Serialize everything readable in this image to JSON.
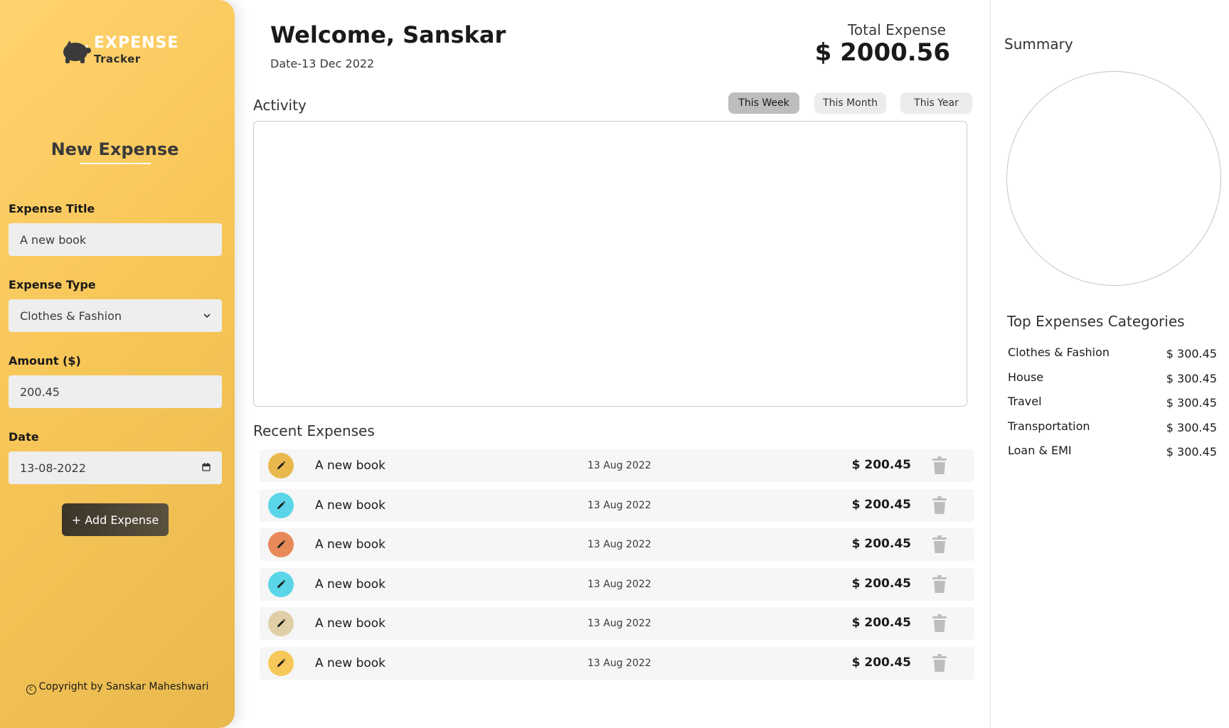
{
  "brand": {
    "title": "EXPENSE",
    "subtitle": "Tracker"
  },
  "form": {
    "heading": "New Expense",
    "title_label": "Expense Title",
    "title_value": "A new book",
    "type_label": "Expense Type",
    "type_value": "Clothes & Fashion",
    "amount_label": "Amount ($)",
    "amount_value": "200.45",
    "date_label": "Date",
    "date_value": "13-08-2022",
    "submit_label": "+ Add Expense"
  },
  "copyright": "Copyright by Sanskar Maheshwari",
  "header": {
    "welcome": "Welcome, Sanskar",
    "date": "Date-13 Dec 2022",
    "total_label": "Total Expense",
    "total_value": "$ 2000.56"
  },
  "activity": {
    "title": "Activity",
    "periods": [
      {
        "label": "This Week",
        "active": true
      },
      {
        "label": "This Month",
        "active": false
      },
      {
        "label": "This Year",
        "active": false
      }
    ]
  },
  "recent": {
    "title": "Recent Expenses",
    "items": [
      {
        "title": "A new book",
        "date": "13 Aug 2022",
        "amount": "$ 200.45",
        "color": "#e9b84d"
      },
      {
        "title": "A new book",
        "date": "13 Aug 2022",
        "amount": "$ 200.45",
        "color": "#5ad6e8"
      },
      {
        "title": "A new book",
        "date": "13 Aug 2022",
        "amount": "$ 200.45",
        "color": "#e8895a"
      },
      {
        "title": "A new book",
        "date": "13 Aug 2022",
        "amount": "$ 200.45",
        "color": "#5ad6e8"
      },
      {
        "title": "A new book",
        "date": "13 Aug 2022",
        "amount": "$ 200.45",
        "color": "#e0cfa6"
      },
      {
        "title": "A new book",
        "date": "13 Aug 2022",
        "amount": "$ 200.45",
        "color": "#f6c85a"
      }
    ]
  },
  "summary": {
    "title": "Summary",
    "categories_title": "Top Expenses Categories",
    "categories": [
      {
        "name": "Clothes & Fashion",
        "amount": "$ 300.45"
      },
      {
        "name": "House",
        "amount": "$ 300.45"
      },
      {
        "name": "Travel",
        "amount": "$ 300.45"
      },
      {
        "name": "Transportation",
        "amount": "$ 300.45"
      },
      {
        "name": "Loan & EMI",
        "amount": "$ 300.45"
      }
    ]
  },
  "icons": {
    "logo": "piggy-bank-icon",
    "select": "chevron-down-icon",
    "date": "calendar-icon",
    "edit": "pencil-icon",
    "delete": "trash-icon",
    "copyright": "copyright-icon"
  }
}
